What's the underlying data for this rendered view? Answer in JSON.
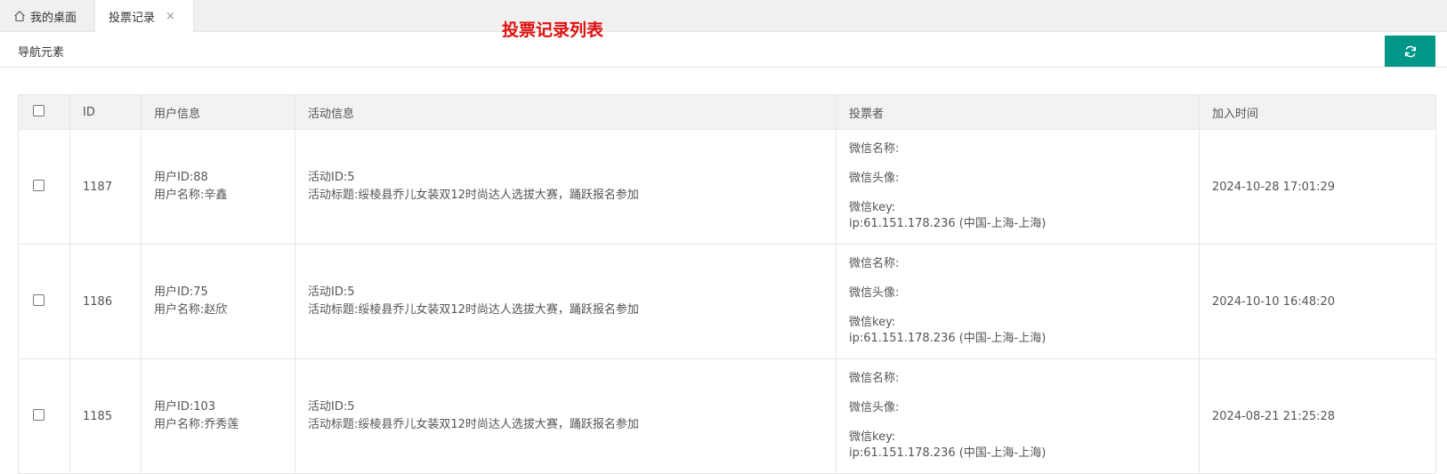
{
  "tabs": {
    "home_label": "我的桌面",
    "active_label": "投票记录",
    "close_glyph": "×"
  },
  "nav": {
    "breadcrumb": "导航元素",
    "page_title": "投票记录列表"
  },
  "table": {
    "headers": [
      "ID",
      "用户信息",
      "活动信息",
      "投票者",
      "加入时间"
    ],
    "rows": [
      {
        "id": "1187",
        "user_id": "用户ID:88",
        "user_name": "用户名称:辛鑫",
        "activity_id": "活动ID:5",
        "activity_title": "活动标题:绥棱县乔儿女装双12时尚达人选拔大赛，踊跃报名参加",
        "wx_name": "微信名称:",
        "wx_avatar": "微信头像:",
        "wx_key": "微信key:",
        "ip": "ip:61.151.178.236  (中国-上海-上海)",
        "time": "2024-10-28 17:01:29"
      },
      {
        "id": "1186",
        "user_id": "用户ID:75",
        "user_name": "用户名称:赵欣",
        "activity_id": "活动ID:5",
        "activity_title": "活动标题:绥棱县乔儿女装双12时尚达人选拔大赛，踊跃报名参加",
        "wx_name": "微信名称:",
        "wx_avatar": "微信头像:",
        "wx_key": "微信key:",
        "ip": "ip:61.151.178.236  (中国-上海-上海)",
        "time": "2024-10-10 16:48:20"
      },
      {
        "id": "1185",
        "user_id": "用户ID:103",
        "user_name": "用户名称:乔秀莲",
        "activity_id": "活动ID:5",
        "activity_title": "活动标题:绥棱县乔儿女装双12时尚达人选拔大赛，踊跃报名参加",
        "wx_name": "微信名称:",
        "wx_avatar": "微信头像:",
        "wx_key": "微信key:",
        "ip": "ip:61.151.178.236  (中国-上海-上海)",
        "time": "2024-08-21 21:25:28"
      }
    ]
  },
  "colors": {
    "accent": "#009688",
    "title_red": "#e01010",
    "header_bg": "#f2f2f2"
  },
  "icons": {
    "home": "home-icon",
    "refresh": "refresh-icon"
  }
}
